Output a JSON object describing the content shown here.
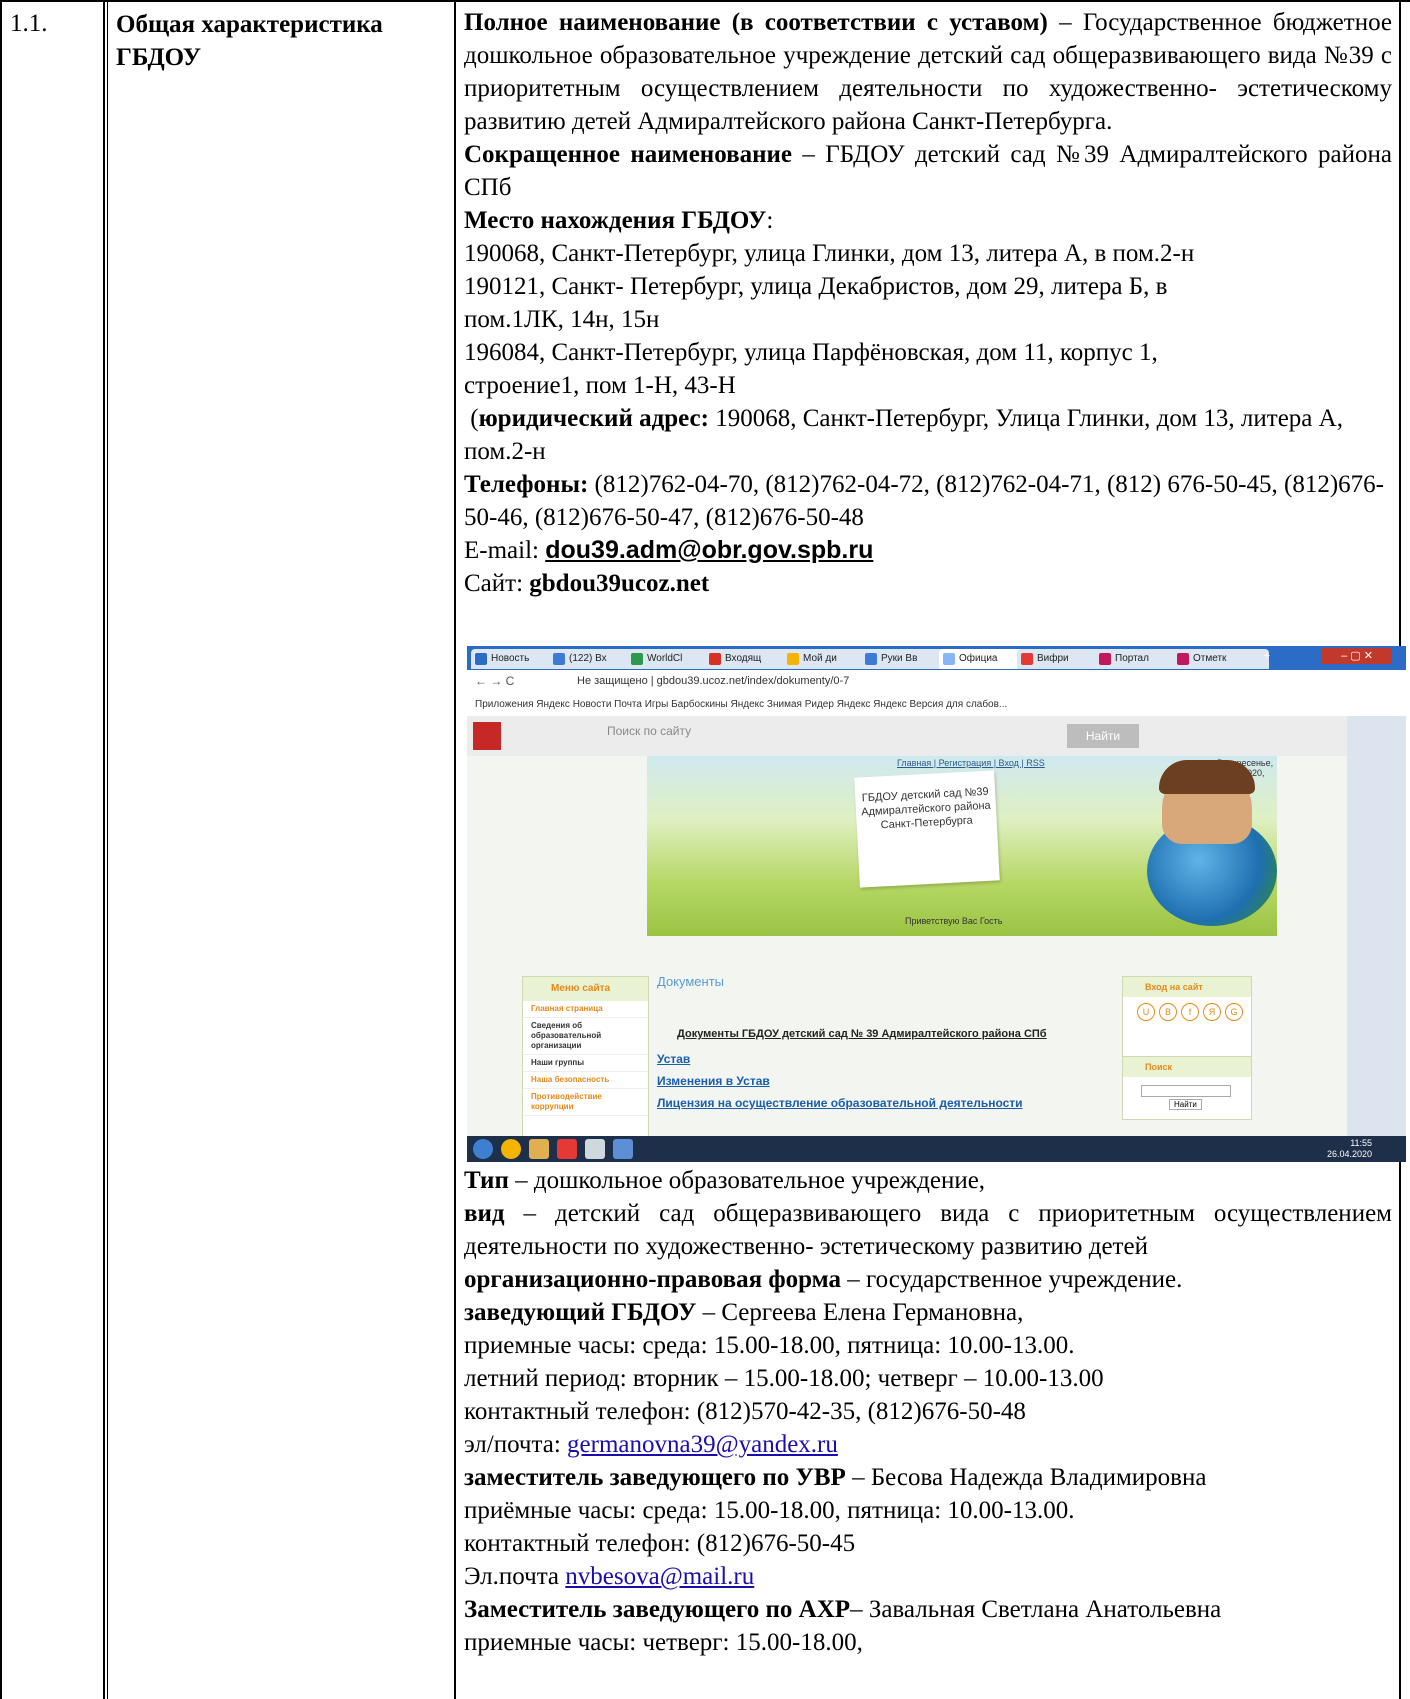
{
  "row_number": "1.1.",
  "section_title": "Общая характеристика ГБДОУ",
  "full_name_label": "Полное наименование (в соответствии с уставом)",
  "full_name_text": " – Государственное бюджетное дошкольное образовательное учреждение детский сад общеразвивающего вида №39 с приоритетным осуществлением деятельности по художественно- эстетическому развитию детей Адмиралтейского района Санкт-Петербурга.",
  "short_name_label": "Сокращенное наименование",
  "short_name_text": " – ГБДОУ детский сад №39 Адмиралтейского района СПб",
  "location_label": "Место нахождения ГБДОУ",
  "addresses": [
    "190068, Санкт-Петербург, улица Глинки, дом 13, литера А, в пом.2-н",
    "190121, Санкт- Петербург, улица Декабристов, дом 29, литера Б, в пом.1ЛК, 14н, 15н",
    "196084, Санкт-Петербург, улица Парфёновская, дом 11, корпус 1, строение1, пом 1-Н, 43-Н"
  ],
  "legal_label": "юридический адрес:",
  "legal_text": " 190068, Санкт-Петербург, Улица Глинки, дом 13, литера А, пом.2-н",
  "phones_label": "Телефоны:",
  "phones_text": " (812)762-04-70, (812)762-04-72, (812)762-04-71, (812) 676-50-45, (812)676-50-46, (812)676-50-47, (812)676-50-48",
  "email_label": "E-mail: ",
  "email": "dou39.adm@obr.gov.spb.ru",
  "site_label": "Сайт: ",
  "site": "gbdou39ucoz.net",
  "screenshot": {
    "tabs": [
      "Новость",
      "(122) Вх",
      "WorldCl",
      "Входящ",
      "Мой ди",
      "Руки Вв",
      "Официа",
      "Вифри",
      "Портал",
      "Отметк"
    ],
    "url": "Не защищено | gbdou39.ucoz.net/index/dokumenty/0-7",
    "bookmarks": "Приложения   Яндекс   Новости   Почта   Игры Барбоскины   Яндекс   Знимая Ридер   Яндекс   Яндекс   Версия для слабов...",
    "search_placeholder": "Поиск по сайту",
    "search_button": "Найти",
    "nav_links": "Главная | Регистрация | Вход | RSS",
    "date": "Воскресенье, 26.04.2020, 11:48",
    "site_title": "ГБДОУ детский сад №39 Адмиралтейского района Санкт-Петербурга",
    "greeting": "Приветствую Вас Гость",
    "menu_title": "Меню сайта",
    "menu_items": [
      "Главная страница",
      "Сведения об образовательной организации",
      "Наши группы",
      "Наша безопасность",
      "Противодействие коррупции"
    ],
    "docs_title": "Документы",
    "docs_heading": "Документы ГБДОУ детский сад № 39 Адмиралтейского района СПб",
    "doc_links": [
      "Устав",
      "Изменения в Устав",
      "Лицензия на осуществление образовательной деятельности"
    ],
    "login_title": "Вход на сайт",
    "search_title": "Поиск",
    "clock_time": "11:55",
    "clock_date": "26.04.2020"
  },
  "type_label": "Тип",
  "type_text": " – дошкольное образовательное учреждение,",
  "kind_label": "вид",
  "kind_text": " – детский сад общеразвивающего вида с приоритетным осуществлением деятельности по художественно- эстетическому развитию детей",
  "form_label": "организационно-правовая форма",
  "form_text": " – государственное учреждение.",
  "head_label": "заведующий ГБДОУ",
  "head_text": " – Сергеева Елена Германовна,",
  "head_hours": "приемные часы: среда: 15.00-18.00, пятница: 10.00-13.00.",
  "head_summer": "летний период: вторник – 15.00-18.00; четверг – 10.00-13.00",
  "head_phone": "контактный телефон: (812)570-42-35, (812)676-50-48",
  "head_email_label": "эл/почта: ",
  "head_email": "germanovna39@yandex.ru",
  "deputy1_label": "заместитель заведующего по УВР",
  "deputy1_text": " – Бесова Надежда Владимировна",
  "deputy1_hours": "приёмные часы: среда: 15.00-18.00, пятница: 10.00-13.00.",
  "deputy1_phone": "контактный телефон: (812)676-50-45",
  "deputy1_email_label": "Эл.почта ",
  "deputy1_email": "nvbesova@mail.ru",
  "deputy2_label": "Заместитель заведующего по АХР",
  "deputy2_text": "– Завальная Светлана Анатольевна",
  "deputy2_hours": "приемные часы: четверг: 15.00-18.00,"
}
